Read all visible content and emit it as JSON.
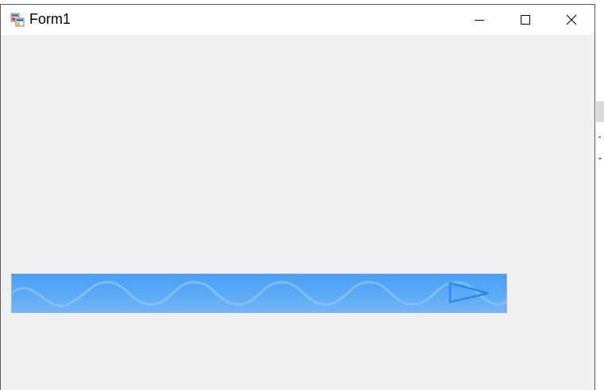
{
  "window": {
    "title": "Form1",
    "icon": "winforms-app-icon",
    "controls": {
      "minimize_icon": "minimize-icon",
      "maximize_icon": "maximize-icon",
      "close_icon": "close-icon"
    }
  },
  "custom_control": {
    "type": "wave-progress-bar",
    "fill_color": "#4aa0f5",
    "wave_color": "#8cc4f5",
    "arrow_color": "#2a8ae8",
    "progress": 1.0
  },
  "colors": {
    "client_background": "#f0f0f0",
    "titlebar_background": "#ffffff"
  }
}
